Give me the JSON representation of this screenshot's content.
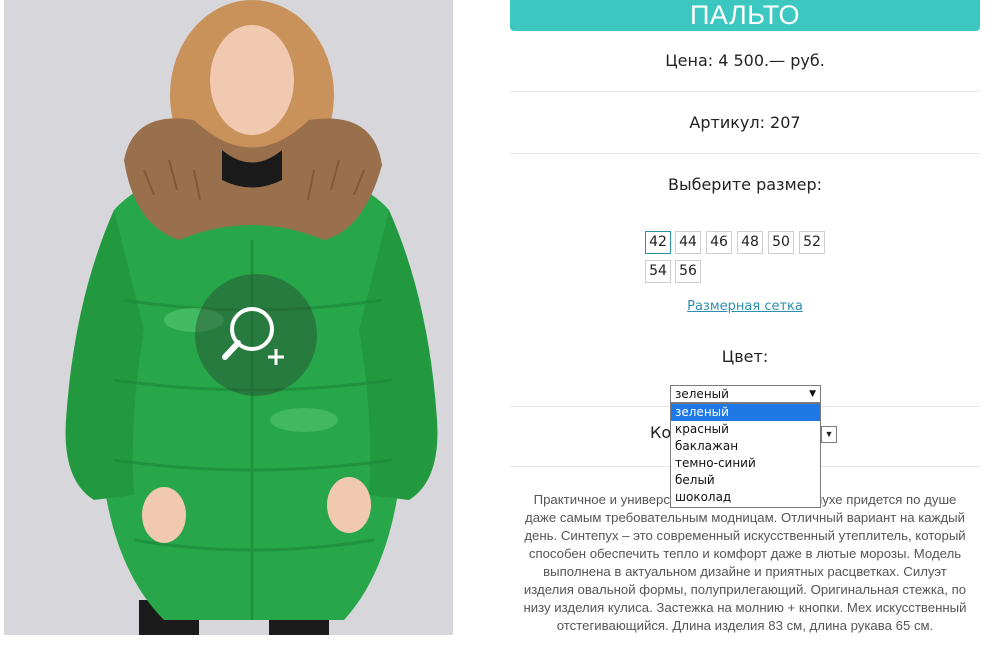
{
  "product": {
    "title": "ПАЛЬТО",
    "price": "Цена: 4 500.— руб.",
    "sku": "Артикул: 207",
    "size_prompt": "Выберите размер:",
    "sizes": [
      "42",
      "44",
      "46",
      "48",
      "50",
      "52",
      "54",
      "56"
    ],
    "selected_size": "42",
    "size_chart_link": "Размерная сетка",
    "color_prompt": "Цвет:",
    "color_selected": "зеленый",
    "color_options": [
      "зеленый",
      "красный",
      "баклажан",
      "темно-синий",
      "белый",
      "шоколад"
    ],
    "quantity_label_visible": "Ко",
    "description": "Практичное и универсальное пальто на синтепухе придется по душе даже самым требовательным модницам. Отличный вариант на каждый день. Синтепух – это современный искусственный утеплитель, который способен обеспечить тепло и комфорт даже в лютые морозы. Модель выполнена в актуальном дизайне и приятных расцветках. Силуэт изделия овальной формы, полуприлегающий. Оригинальная стежка, по низу изделия кулиса. Застежка на молнию + кнопки. Мех искусственный отстегивающийся. Длина изделия 83 см, длина рукава 65 см."
  },
  "colors": {
    "accent": "#3cc8c0",
    "coat": "#27a64a",
    "link": "#2b8fb0",
    "highlight": "#1e78e6"
  },
  "icons": {
    "zoom": "magnifier-plus-icon"
  }
}
